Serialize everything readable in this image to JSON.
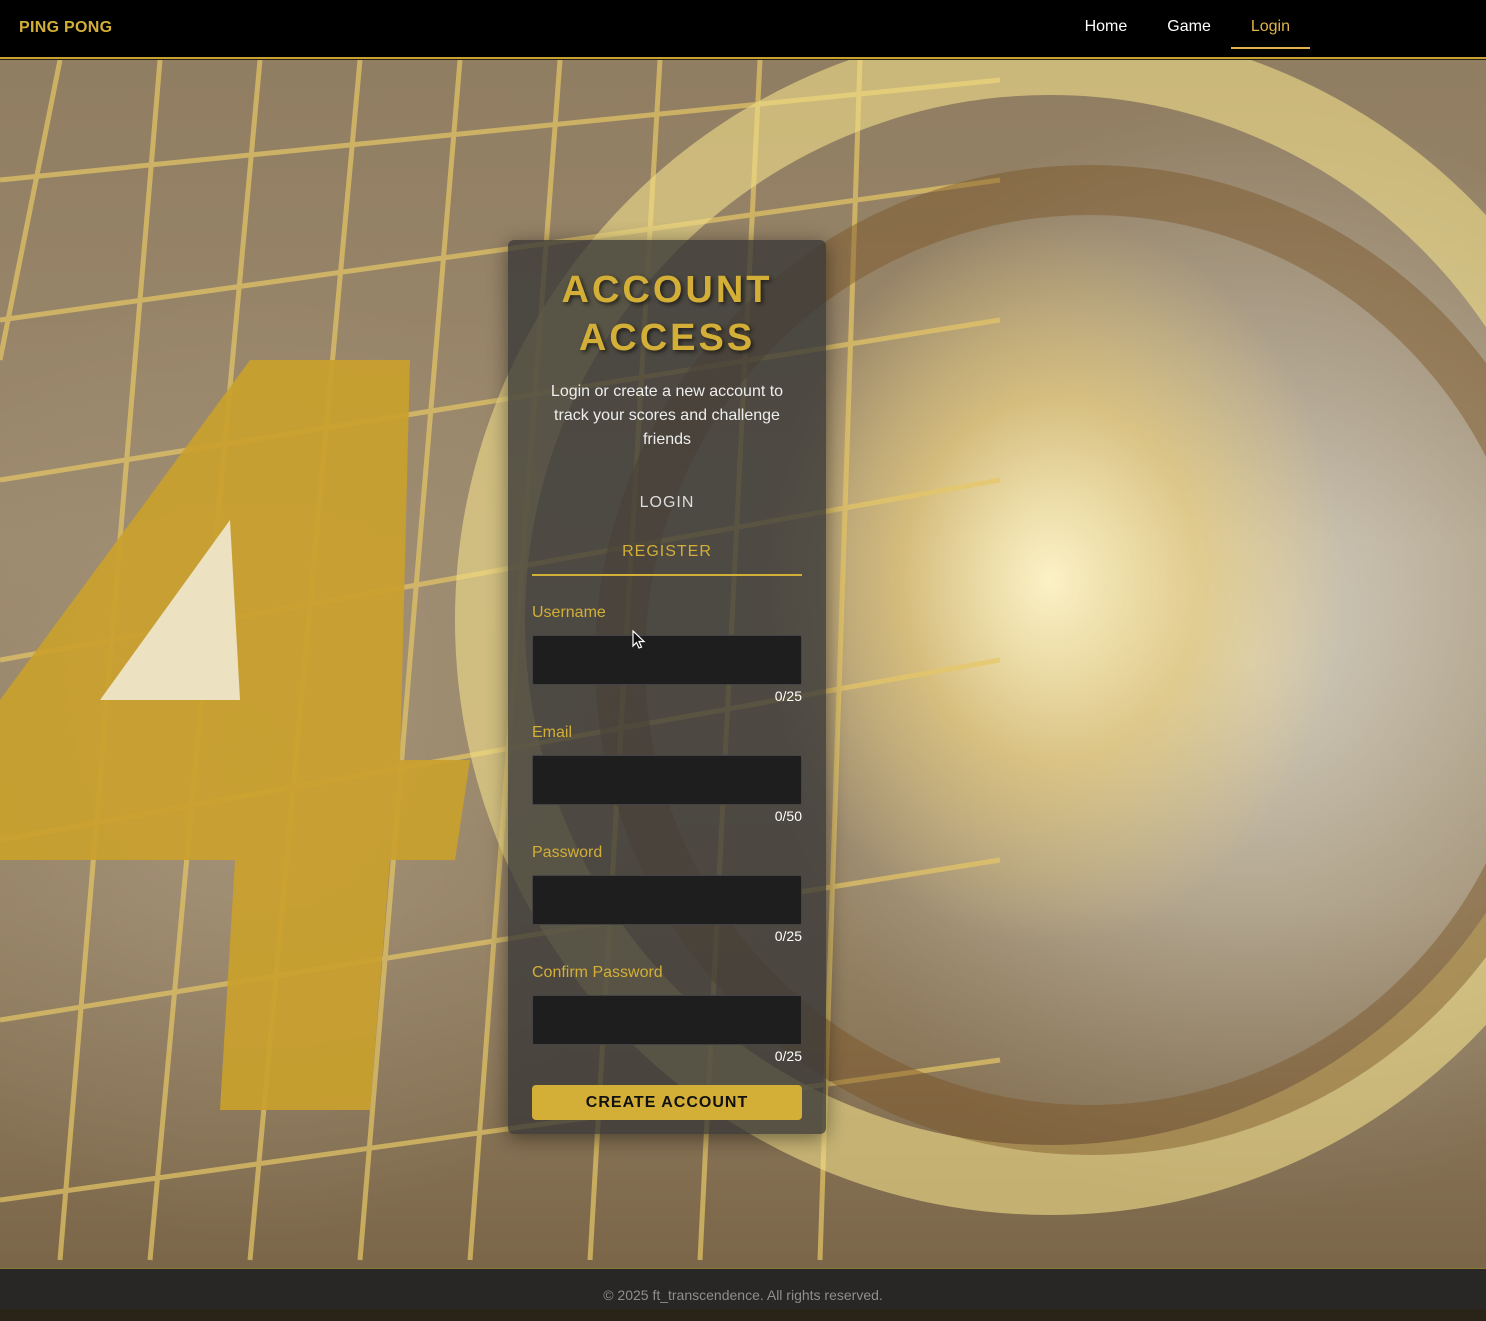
{
  "nav": {
    "brand": "PING PONG",
    "links": [
      {
        "label": "Home",
        "active": false
      },
      {
        "label": "Game",
        "active": false
      },
      {
        "label": "Login",
        "active": true
      }
    ]
  },
  "card": {
    "title_line1": "ACCOUNT",
    "title_line2": "ACCESS",
    "subtitle": "Login or create a new account to track your scores and challenge friends",
    "tabs": {
      "login": "LOGIN",
      "register": "REGISTER",
      "active": "register"
    },
    "fields": [
      {
        "label": "Username",
        "value": "",
        "counter": "0/25",
        "type": "text"
      },
      {
        "label": "Email",
        "value": "",
        "counter": "0/50",
        "type": "email"
      },
      {
        "label": "Password",
        "value": "",
        "counter": "0/25",
        "type": "password"
      },
      {
        "label": "Confirm Password",
        "value": "",
        "counter": "0/25",
        "type": "password"
      }
    ],
    "submit_label": "CREATE ACCOUNT"
  },
  "footer": {
    "text": "© 2025 ft_transcendence. All rights reserved."
  },
  "colors": {
    "accent": "#d4af37",
    "nav_bg": "#000000",
    "card_bg": "rgba(55,55,55,0.78)"
  }
}
